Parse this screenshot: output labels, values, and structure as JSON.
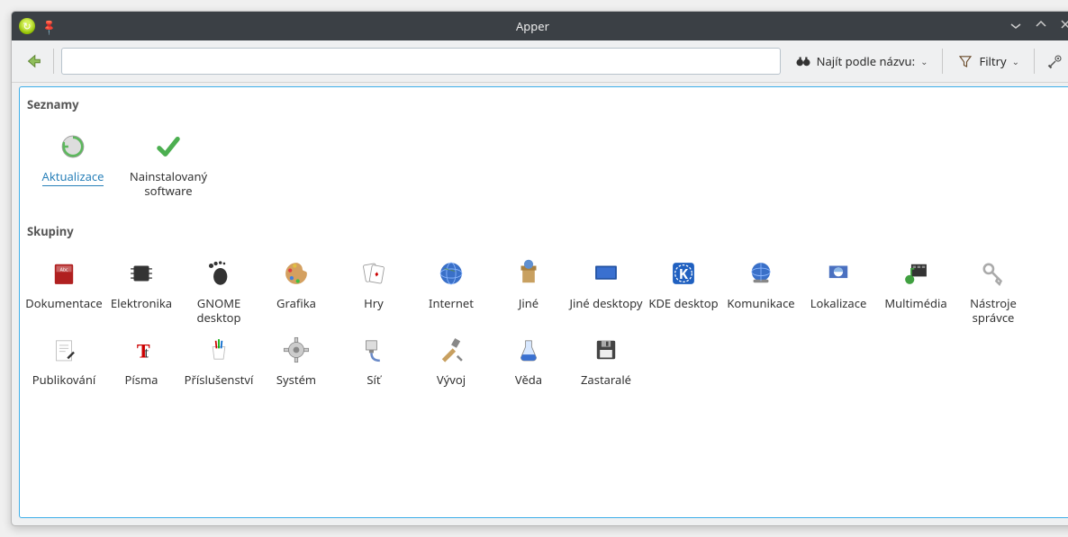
{
  "window": {
    "title": "Apper"
  },
  "toolbar": {
    "search_value": "",
    "search_by_label": "Najít podle názvu:",
    "filters_label": "Filtry"
  },
  "sections": {
    "lists_title": "Seznamy",
    "groups_title": "Skupiny"
  },
  "lists": [
    {
      "id": "updates",
      "label": "Aktualizace",
      "selected": true
    },
    {
      "id": "installed",
      "label": "Nainstalovaný software",
      "selected": false
    }
  ],
  "groups": [
    {
      "id": "documentation",
      "label": "Dokumentace"
    },
    {
      "id": "electronics",
      "label": "Elektronika"
    },
    {
      "id": "gnome-desktop",
      "label": "GNOME desktop"
    },
    {
      "id": "graphics",
      "label": "Grafika"
    },
    {
      "id": "games",
      "label": "Hry"
    },
    {
      "id": "internet",
      "label": "Internet"
    },
    {
      "id": "other",
      "label": "Jiné"
    },
    {
      "id": "other-desktops",
      "label": "Jiné desktopy"
    },
    {
      "id": "kde-desktop",
      "label": "KDE desktop"
    },
    {
      "id": "communication",
      "label": "Komunikace"
    },
    {
      "id": "localization",
      "label": "Lokalizace"
    },
    {
      "id": "multimedia",
      "label": "Multimédia"
    },
    {
      "id": "admin-tools",
      "label": "Nástroje správce"
    },
    {
      "id": "publishing",
      "label": "Publikování"
    },
    {
      "id": "fonts",
      "label": "Písma"
    },
    {
      "id": "accessories",
      "label": "Příslušenství"
    },
    {
      "id": "system",
      "label": "Systém"
    },
    {
      "id": "network",
      "label": "Síť"
    },
    {
      "id": "development",
      "label": "Vývoj"
    },
    {
      "id": "science",
      "label": "Věda"
    },
    {
      "id": "legacy",
      "label": "Zastaralé"
    }
  ]
}
